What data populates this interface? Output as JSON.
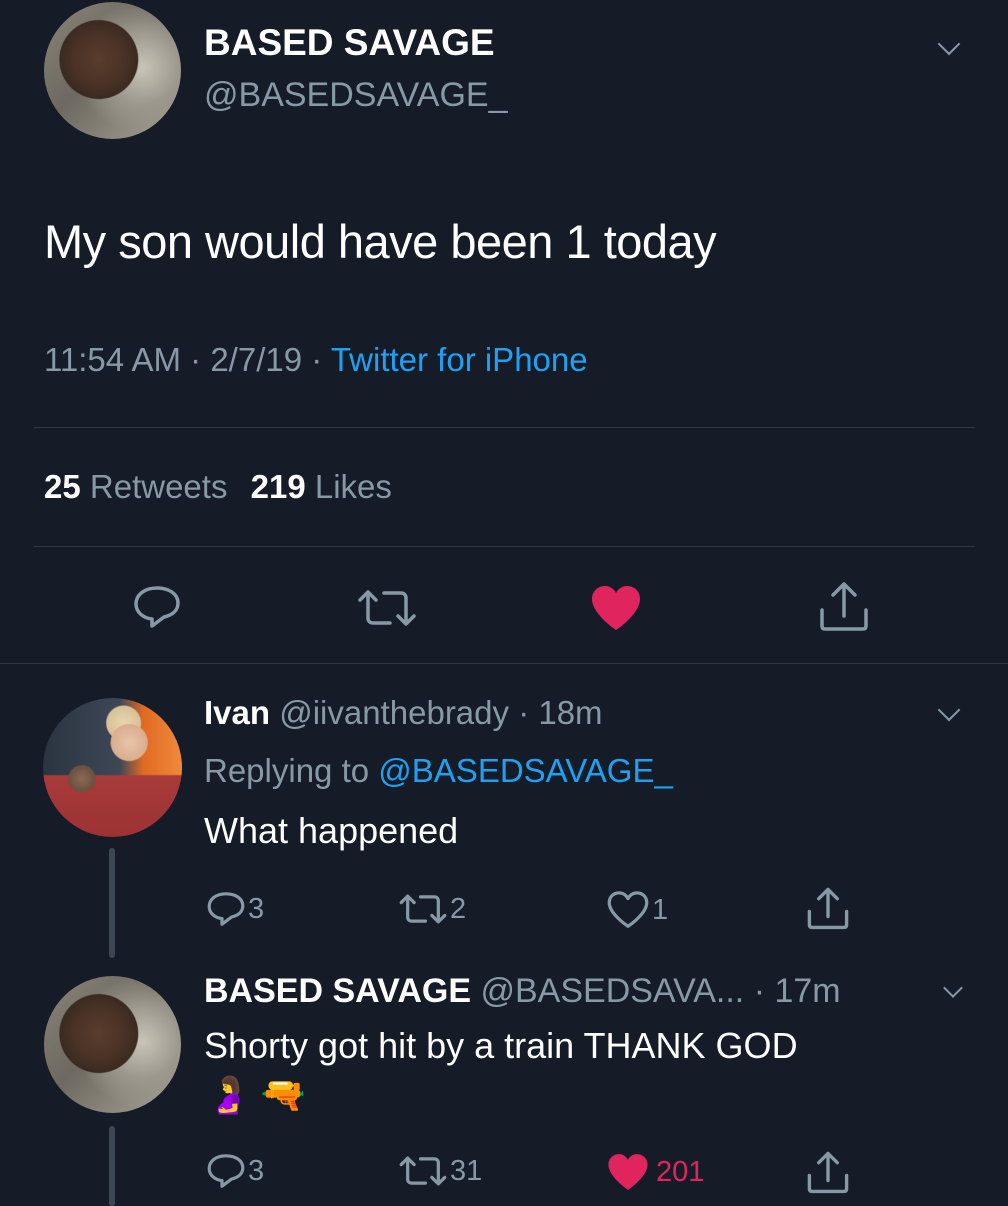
{
  "tweet": {
    "author_name": "BASED SAVAGE",
    "author_handle": "@BASEDSAVAGE_",
    "text": "My son would have been 1 today",
    "time": "11:54 AM",
    "date": "2/7/19",
    "source": "Twitter for iPhone",
    "sep": "·",
    "retweets_count": "25",
    "retweets_label": "Retweets",
    "likes_count": "219",
    "likes_label": "Likes",
    "liked": true
  },
  "replies": [
    {
      "author_name": "Ivan",
      "author_handle": "@iivanthebrady",
      "age": "· 18m",
      "replying_prefix": "Replying to",
      "replying_to": "@BASEDSAVAGE_",
      "text": "What happened",
      "reply_count": "3",
      "retweet_count": "2",
      "like_count": "1",
      "liked": false
    },
    {
      "author_name": "BASED SAVAGE",
      "author_handle": "@BASEDSAVA...",
      "age": "· 17m",
      "text": "Shorty got hit by a train THANK GOD",
      "emoji": "🤰🔫",
      "reply_count": "3",
      "retweet_count": "31",
      "like_count": "201",
      "liked": true
    }
  ],
  "colors": {
    "background": "#151b27",
    "link": "#1da1f2",
    "muted": "#8899a6",
    "like": "#e0245e"
  },
  "icons": [
    "chevron-down-icon",
    "reply-icon",
    "retweet-icon",
    "heart-icon",
    "share-icon"
  ]
}
